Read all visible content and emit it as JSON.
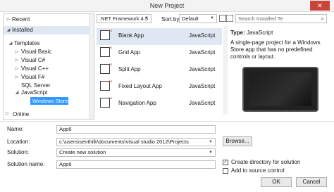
{
  "window": {
    "title": "New Project",
    "close": "✕"
  },
  "tree": {
    "recent": "Recent",
    "installed": "Installed",
    "templates": "Templates",
    "items": [
      "Visual Basic",
      "Visual C#",
      "Visual C++",
      "Visual F#",
      "SQL Server",
      "JavaScript"
    ],
    "windows_store": "Windows Store",
    "online": "Online"
  },
  "toolbar": {
    "framework": ".NET Framework 4.5",
    "sort_by_label": "Sort by:",
    "sort_by_value": "Default",
    "search_placeholder": "Search Installed Te"
  },
  "templates": [
    {
      "name": "Blank App",
      "lang": "JavaScript"
    },
    {
      "name": "Grid App",
      "lang": "JavaScript"
    },
    {
      "name": "Split App",
      "lang": "JavaScript"
    },
    {
      "name": "Fixed Layout App",
      "lang": "JavaScript"
    },
    {
      "name": "Navigation App",
      "lang": "JavaScript"
    }
  ],
  "details": {
    "type_label": "Type:",
    "type_value": "JavaScript",
    "description": "A single-page project for a Windows Store app that has no predefined controls or layout."
  },
  "form": {
    "name_label": "Name:",
    "name_value": "App6",
    "location_label": "Location:",
    "location_value": "c:\\users\\senthilk\\documents\\visual studio 2012\\Projects",
    "solution_label": "Solution:",
    "solution_value": "Create new solution",
    "solution_name_label": "Solution name:",
    "solution_name_value": "App6",
    "browse": "Browse...",
    "create_dir": "Create directory for solution",
    "add_source": "Add to source control",
    "ok": "OK",
    "cancel": "Cancel"
  }
}
